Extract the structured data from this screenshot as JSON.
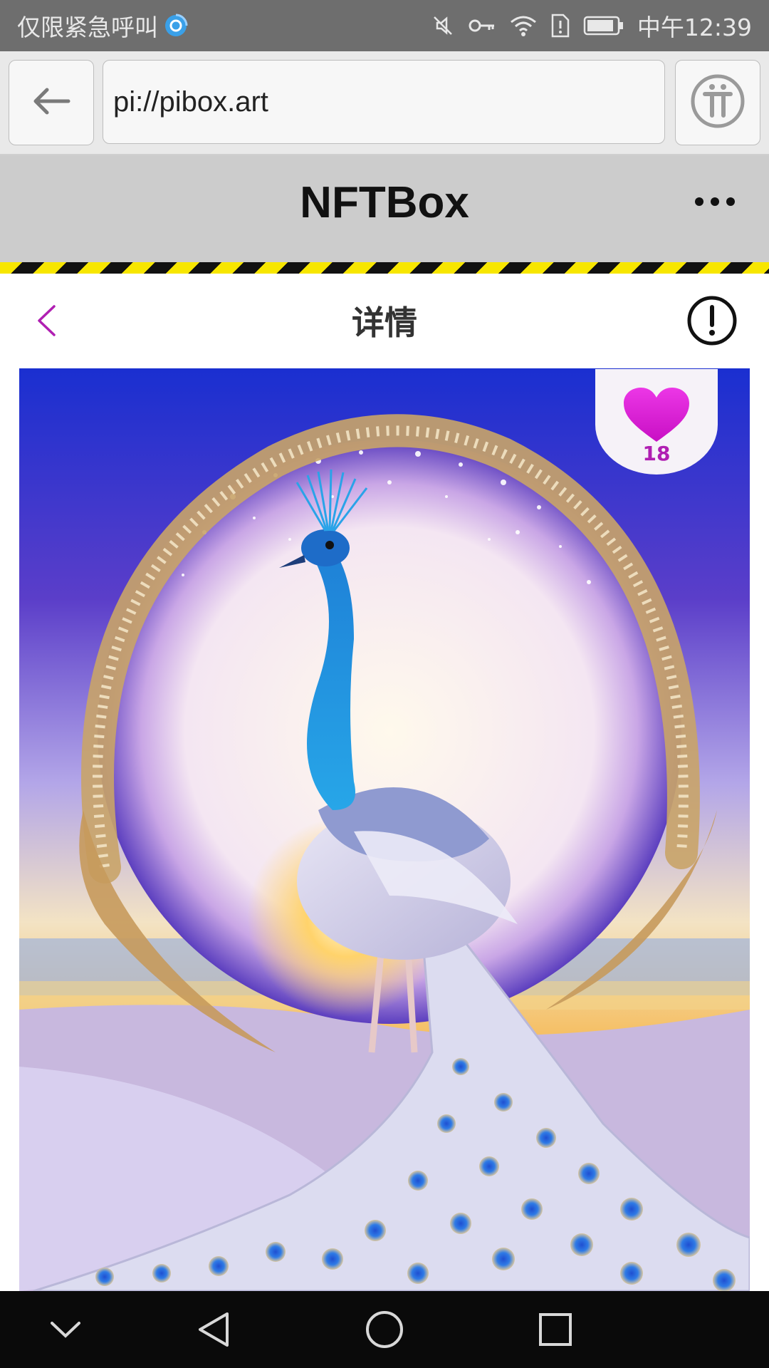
{
  "status_bar": {
    "carrier": "仅限紧急呼叫",
    "time": "中午12:39",
    "icons": [
      "mute-icon",
      "key-icon",
      "wifi-icon",
      "sim-alert-icon",
      "battery-icon"
    ]
  },
  "browser": {
    "url": "pi://pibox.art",
    "back_icon": "arrow-left-icon",
    "pi_icon": "pi-logo-icon"
  },
  "app": {
    "title": "NFTBox",
    "more_icon": "more-dots-icon"
  },
  "page": {
    "title": "详情",
    "back_icon": "chevron-left-icon",
    "info_icon": "info-alert-icon"
  },
  "artwork": {
    "likes": "18",
    "like_icon": "heart-icon"
  },
  "colors": {
    "accent": "#b01fb2",
    "heart": "#e020d6",
    "hazard_yellow": "#f7e600",
    "header_bg": "#cccccc"
  },
  "nav": {
    "buttons": [
      "collapse-icon",
      "back-triangle-icon",
      "home-circle-icon",
      "recents-square-icon"
    ]
  }
}
